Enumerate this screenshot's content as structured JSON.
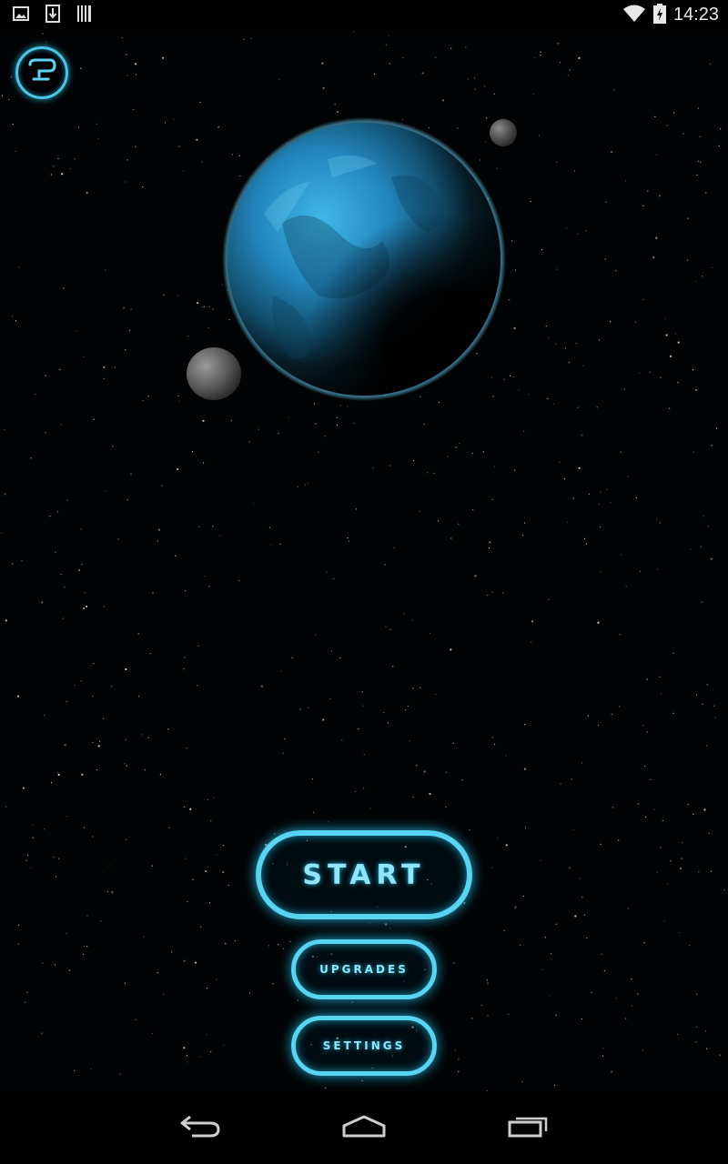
{
  "status_bar": {
    "time": "14:23",
    "left_icons": [
      "image-icon",
      "download-icon",
      "barcode-icon"
    ],
    "right_icons": [
      "wifi-icon",
      "battery-charging-icon"
    ]
  },
  "menu": {
    "start_label": "START",
    "upgrades_label": "UPGRADES",
    "settings_label": "SETTINGS"
  },
  "help_button": {
    "icon": "help-icon"
  },
  "nav_bar": {
    "icons": [
      "back-icon",
      "home-icon",
      "recents-icon"
    ]
  },
  "colors": {
    "accent": "#59d4f0",
    "accent_glow": "#1fa9d2",
    "planet": "#2a8fc4",
    "background": "#000000"
  }
}
